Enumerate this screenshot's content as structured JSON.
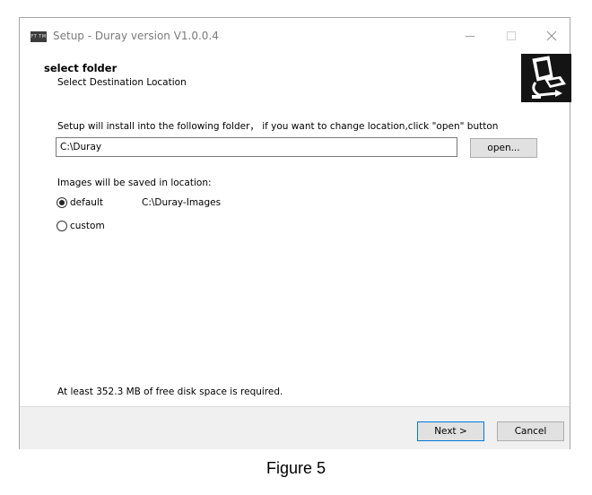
{
  "window": {
    "title": "Setup - Duray version V1.0.0.4",
    "app_icon_label": "FT TM",
    "controls": [
      "minimize-icon",
      "maximize-icon",
      "close-icon"
    ]
  },
  "header": {
    "title": "select folder",
    "subtitle": "Select Destination Location",
    "icon": "computer-setup-icon"
  },
  "install": {
    "instruction": "Setup will install into the following folder， if you want to change location,click \"open\" button",
    "path_value": "C:\\Duray",
    "open_label": "open..."
  },
  "images": {
    "label": "Images will be saved in location:",
    "default_label": "default",
    "default_path": "C:\\Duray-Images",
    "custom_label": "custom",
    "selected": "default"
  },
  "disk_space": "At least 352.3 MB of free disk space is required.",
  "footer": {
    "next_label": "Next >",
    "cancel_label": "Cancel"
  },
  "caption": "Figure 5",
  "colors": {
    "accent": "#0078d7",
    "footer_bg": "#f0f0f0",
    "button_bg": "#e1e1e1"
  }
}
